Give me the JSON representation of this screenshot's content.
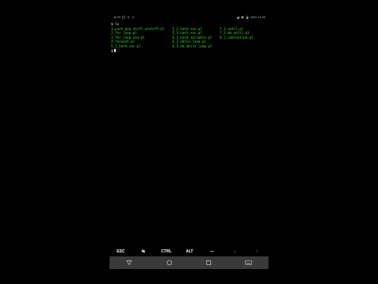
{
  "status_bar": {
    "left_text": "8:19 ",
    "right_text": "46% 11:30",
    "icons_left": [
      "sms-icon",
      "wifi-small-icon",
      "usb-icon"
    ],
    "icons_right": [
      "signal-icon",
      "wifi-icon",
      "battery-icon"
    ]
  },
  "terminal": {
    "command_line": "$ ls",
    "listing_columns": [
      [
        "1_push_pop_shift_unshift.pl",
        "2_for_loop.pl",
        "3_for_loop_seq.pl",
        "4_foreach.pl",
        "5_1_hash_var.pl"
      ],
      [
        "5_2_hash_var.pl",
        "5_3_hash_var.pl",
        "6_1_hash_variable.pl",
        "6_2_while_loop.pl",
        "6_3_do_while_loop.pl"
      ],
      [
        "7_1_until.pl",
        "7_2_do_until.pl",
        "8_1_subroutine.pl"
      ]
    ],
    "prompt": "$"
  },
  "extra_keys": [
    "ESC",
    "↹",
    "CTRL",
    "ALT",
    "—",
    "↓",
    "↑"
  ],
  "nav": [
    "back-icon",
    "home-icon",
    "recents-icon",
    "keyboard-icon"
  ]
}
